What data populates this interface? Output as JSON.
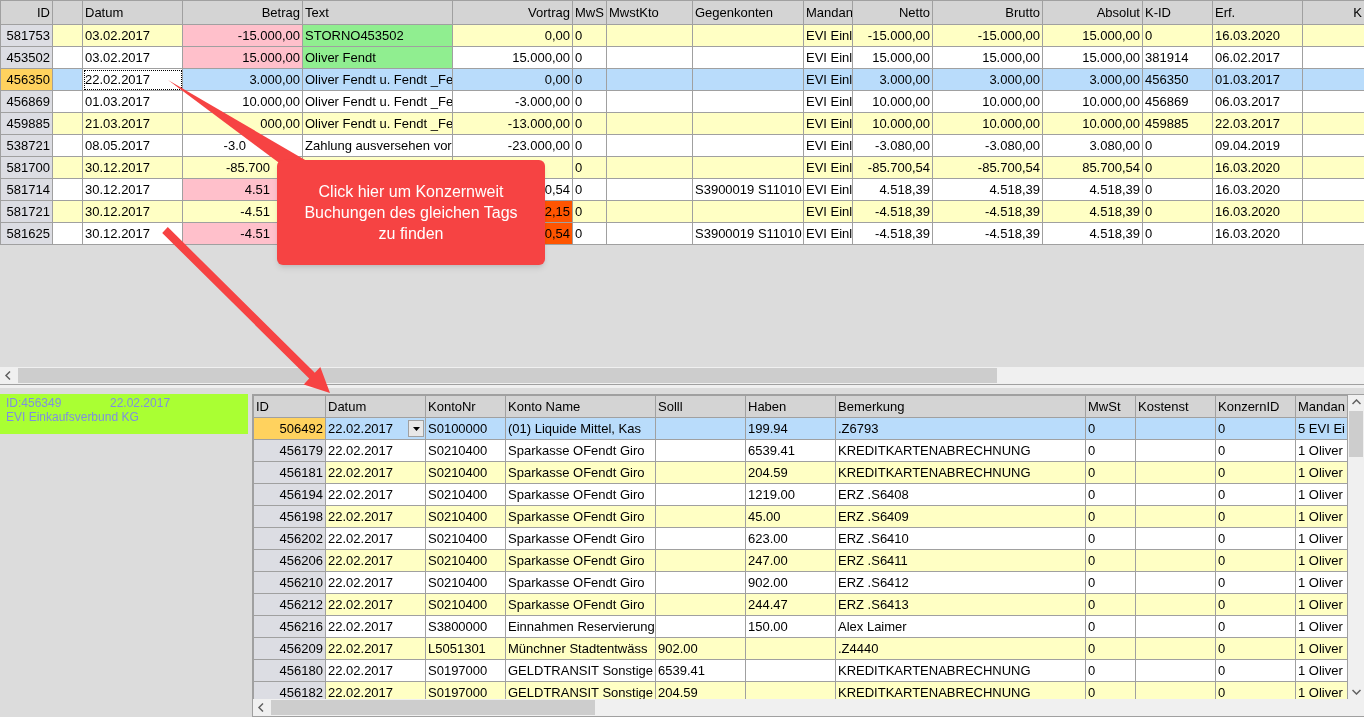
{
  "top_table": {
    "columns": [
      {
        "label": "ID"
      },
      {},
      {
        "label": "Datum"
      },
      {
        "label": "Betrag"
      },
      {
        "label": "Text"
      },
      {
        "label": "Vortrag"
      },
      {
        "label": "MwS"
      },
      {
        "label": "MwstKto"
      },
      {
        "label": "Gegenkonten"
      },
      {
        "label": "Mandan"
      },
      {
        "label": "Netto"
      },
      {
        "label": "Brutto"
      },
      {
        "label": "Absolut"
      },
      {
        "label": "K-ID"
      },
      {
        "label": "Erf."
      },
      {
        "label": "K"
      }
    ],
    "rows": [
      {
        "selected": false,
        "cells": [
          "581753",
          null,
          "03.02.2017",
          {
            "text": "-15.000,00",
            "color": "#ffc0cb"
          },
          {
            "text": "STORNO453502",
            "color": "#90ee90"
          },
          "0,00",
          "0",
          null,
          null,
          "EVI Einl",
          "-15.000,00",
          "-15.000,00",
          "15.000,00",
          "0",
          "16.03.2020",
          null
        ]
      },
      {
        "selected": false,
        "cells": [
          "453502",
          null,
          "03.02.2017",
          {
            "text": "15.000,00",
            "color": "#ffc0cb"
          },
          {
            "text": "Oliver Fendt",
            "color": "#90ee90"
          },
          "15.000,00",
          "0",
          null,
          null,
          "EVI Einl",
          "15.000,00",
          "15.000,00",
          "15.000,00",
          "381914",
          "06.02.2017",
          null
        ]
      },
      {
        "selected": true,
        "cells": [
          "456350",
          null,
          "22.02.2017",
          "3.000,00",
          "Oliver Fendt u. Fendt _Fe",
          "0,00",
          "0",
          null,
          null,
          "EVI Einl",
          "3.000,00",
          "3.000,00",
          "3.000,00",
          "456350",
          "01.03.2017",
          null
        ]
      },
      {
        "selected": false,
        "cells": [
          "456869",
          null,
          "01.03.2017",
          "10.000,00",
          "Oliver Fendt u. Fendt _Fe",
          "-3.000,00",
          "0",
          null,
          null,
          "EVI Einl",
          "10.000,00",
          "10.000,00",
          "10.000,00",
          "456869",
          "06.03.2017",
          null
        ]
      },
      {
        "selected": false,
        "cells": [
          "459885",
          null,
          "21.03.2017",
          "000,00",
          "Oliver Fendt u. Fendt _Fe",
          "-13.000,00",
          "0",
          null,
          null,
          "EVI Einl",
          "10.000,00",
          "10.000,00",
          "10.000,00",
          "459885",
          "22.03.2017",
          null
        ]
      },
      {
        "selected": false,
        "cells": [
          "538721",
          null,
          "08.05.2017",
          "-3.0",
          "Zahlung ausversehen vor",
          "-23.000,00",
          "0",
          null,
          null,
          "EVI Einl",
          "-3.080,00",
          "-3.080,00",
          "3.080,00",
          "0",
          "09.04.2019",
          null
        ]
      },
      {
        "selected": false,
        "cells": [
          "581700",
          null,
          "30.12.2017",
          "-85.700",
          null,
          null,
          "0",
          null,
          null,
          "EVI Einl",
          "-85.700,54",
          "-85.700,54",
          "85.700,54",
          "0",
          "16.03.2020",
          null
        ]
      },
      {
        "selected": false,
        "cells": [
          "581714",
          null,
          "30.12.2017",
          {
            "text": "4.51",
            "color": "#ffc0cb"
          },
          null,
          "0,54",
          "0",
          null,
          "S3900019 S11010",
          "EVI Einl",
          "4.518,39",
          "4.518,39",
          "4.518,39",
          "0",
          "16.03.2020",
          null
        ]
      },
      {
        "selected": false,
        "cells": [
          "581721",
          null,
          "30.12.2017",
          "-4.51",
          null,
          {
            "text": "2,15",
            "color": "#ff5500"
          },
          "0",
          null,
          null,
          "EVI Einl",
          "-4.518,39",
          "-4.518,39",
          "4.518,39",
          "0",
          "16.03.2020",
          null
        ]
      },
      {
        "selected": false,
        "cells": [
          "581625",
          null,
          "30.12.2017",
          {
            "text": "-4.51",
            "color": "#ffc0cb"
          },
          null,
          {
            "text": "0,54",
            "color": "#ff5500"
          },
          "0",
          null,
          "S3900019 S11010",
          "EVI Einl",
          "-4.518,39",
          "-4.518,39",
          "4.518,39",
          "0",
          "16.03.2020",
          null
        ]
      }
    ]
  },
  "callout": {
    "text": "Click hier um Konzernweit Buchungen des gleichen Tags zu finden"
  },
  "info_panel": {
    "id": "ID:456349",
    "date": "22.02.2017",
    "company": "EVI Einkaufsverbund KG"
  },
  "bottom_table": {
    "columns": [
      {
        "label": "ID",
        "kind": "id"
      },
      {
        "label": "Datum",
        "kind": "date"
      },
      {
        "label": "KontoNr",
        "kind": "text"
      },
      {
        "label": "Konto Name",
        "kind": "text"
      },
      {
        "label": "Solll",
        "kind": "text"
      },
      {
        "label": "Haben",
        "kind": "text"
      },
      {
        "label": "Bemerkung",
        "kind": "text"
      },
      {
        "label": "MwSt",
        "kind": "text"
      },
      {
        "label": "Kostenst",
        "kind": "text"
      },
      {
        "label": "KonzernID",
        "kind": "text"
      },
      {
        "label": "Mandan",
        "kind": "text"
      }
    ],
    "rows": [
      {
        "selected": true,
        "cells": [
          "506492",
          "22.02.2017",
          "S0100000",
          "(01) Liquide Mittel, Kas",
          null,
          "199.94",
          ".Z6793",
          "0",
          null,
          "0",
          "5 EVI Ei"
        ]
      },
      {
        "selected": false,
        "cells": [
          "456179",
          "22.02.2017",
          "S0210400",
          "Sparkasse OFendt Giro",
          null,
          "6539.41",
          "KREDITKARTENABRECHNUNG",
          "0",
          null,
          "0",
          "1 Oliver"
        ]
      },
      {
        "selected": false,
        "cells": [
          "456181",
          "22.02.2017",
          "S0210400",
          "Sparkasse OFendt Giro",
          null,
          "204.59",
          "KREDITKARTENABRECHNUNG",
          "0",
          null,
          "0",
          "1 Oliver"
        ]
      },
      {
        "selected": false,
        "cells": [
          "456194",
          "22.02.2017",
          "S0210400",
          "Sparkasse OFendt Giro",
          null,
          "1219.00",
          "ERZ .S6408",
          "0",
          null,
          "0",
          "1 Oliver"
        ]
      },
      {
        "selected": false,
        "cells": [
          "456198",
          "22.02.2017",
          "S0210400",
          "Sparkasse OFendt Giro",
          null,
          "45.00",
          "ERZ .S6409",
          "0",
          null,
          "0",
          "1 Oliver"
        ]
      },
      {
        "selected": false,
        "cells": [
          "456202",
          "22.02.2017",
          "S0210400",
          "Sparkasse OFendt Giro",
          null,
          "623.00",
          "ERZ .S6410",
          "0",
          null,
          "0",
          "1 Oliver"
        ]
      },
      {
        "selected": false,
        "cells": [
          "456206",
          "22.02.2017",
          "S0210400",
          "Sparkasse OFendt Giro",
          null,
          "247.00",
          "ERZ .S6411",
          "0",
          null,
          "0",
          "1 Oliver"
        ]
      },
      {
        "selected": false,
        "cells": [
          "456210",
          "22.02.2017",
          "S0210400",
          "Sparkasse OFendt Giro",
          null,
          "902.00",
          "ERZ .S6412",
          "0",
          null,
          "0",
          "1 Oliver"
        ]
      },
      {
        "selected": false,
        "cells": [
          "456212",
          "22.02.2017",
          "S0210400",
          "Sparkasse OFendt Giro",
          null,
          "244.47",
          "ERZ .S6413",
          "0",
          null,
          "0",
          "1 Oliver"
        ]
      },
      {
        "selected": false,
        "cells": [
          "456216",
          "22.02.2017",
          "S3800000",
          "Einnahmen Reservierung",
          null,
          "150.00",
          "Alex Laimer",
          "0",
          null,
          "0",
          "1 Oliver"
        ]
      },
      {
        "selected": false,
        "cells": [
          "456209",
          "22.02.2017",
          "L5051301",
          "Münchner Stadtentwäss",
          "902.00",
          null,
          ".Z4440",
          "0",
          null,
          "0",
          "1 Oliver"
        ]
      },
      {
        "selected": false,
        "cells": [
          "456180",
          "22.02.2017",
          "S0197000",
          "GELDTRANSIT Sonstige",
          "6539.41",
          null,
          "KREDITKARTENABRECHNUNG",
          "0",
          null,
          "0",
          "1 Oliver"
        ]
      },
      {
        "selected": false,
        "cells": [
          "456182",
          "22.02.2017",
          "S0197000",
          "GELDTRANSIT Sonstige",
          "204.59",
          null,
          "KREDITKARTENABRECHNUNG",
          "0",
          null,
          "0",
          "1 Oliver"
        ]
      }
    ]
  }
}
